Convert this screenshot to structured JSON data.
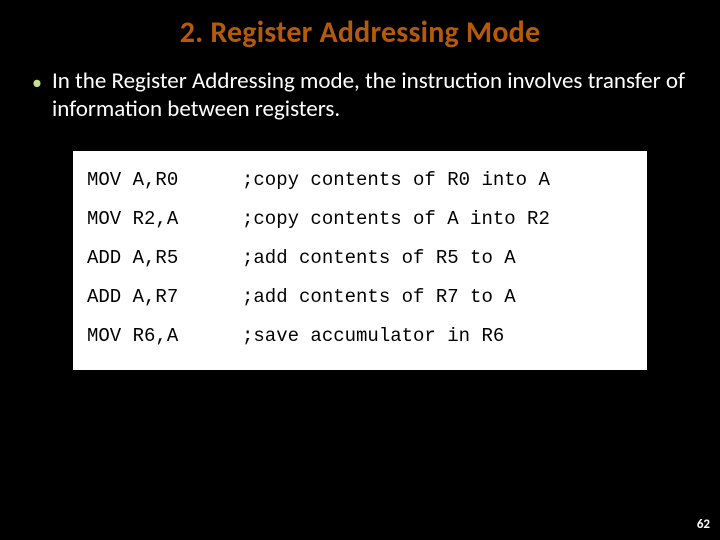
{
  "title": "2. Register Addressing Mode",
  "bullet": "In the Register Addressing mode, the instruction involves transfer of information between registers.",
  "code": {
    "rows": [
      {
        "instr": "MOV A,R0",
        "comment": ";copy contents of R0 into A"
      },
      {
        "instr": "MOV R2,A",
        "comment": ";copy contents of A into R2"
      },
      {
        "instr": "ADD A,R5",
        "comment": ";add contents of R5 to A"
      },
      {
        "instr": "ADD A,R7",
        "comment": ";add contents of R7 to A"
      },
      {
        "instr": "MOV R6,A",
        "comment": ";save accumulator in R6"
      }
    ]
  },
  "page_number": "62"
}
